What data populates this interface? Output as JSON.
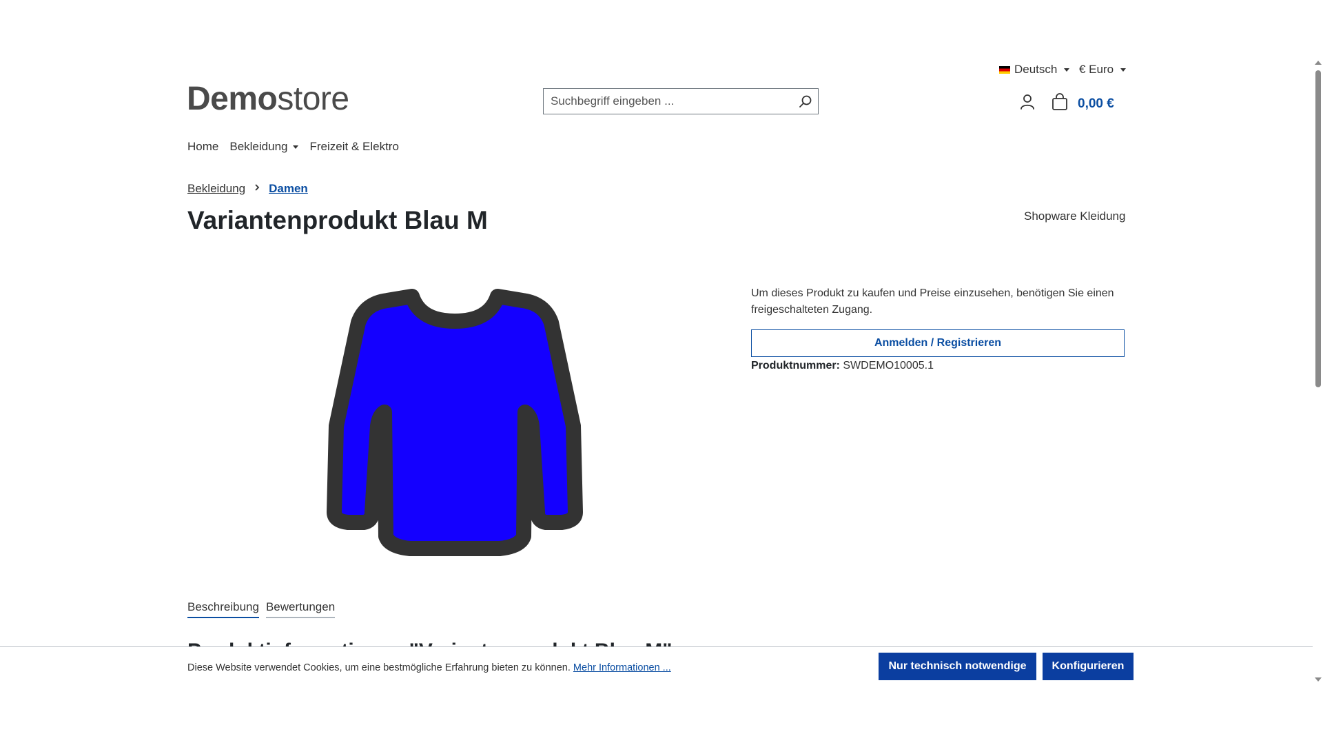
{
  "topbar": {
    "language": "Deutsch",
    "currency": "€ Euro"
  },
  "header": {
    "logo_bold": "Demo",
    "logo_light": "store",
    "search_placeholder": "Suchbegriff eingeben ...",
    "cart_total": "0,00 €"
  },
  "nav": {
    "items": [
      {
        "label": "Home",
        "has_dropdown": false
      },
      {
        "label": "Bekleidung",
        "has_dropdown": true
      },
      {
        "label": "Freizeit & Elektro",
        "has_dropdown": false
      }
    ]
  },
  "breadcrumb": {
    "items": [
      "Bekleidung",
      "Damen"
    ]
  },
  "product": {
    "title": "Variantenprodukt Blau M",
    "manufacturer": "Shopware Kleidung",
    "image_color": "#1400ff",
    "image_outline": "#333333",
    "buy_notice": "Um dieses Produkt zu kaufen und Preise einzusehen, benötigen Sie einen freigeschalteten Zugang.",
    "login_button": "Anmelden / Registrieren",
    "product_number_label": "Produktnummer:",
    "product_number": "SWDEMO10005.1"
  },
  "tabs": {
    "items": [
      "Beschreibung",
      "Bewertungen"
    ]
  },
  "description": {
    "title": "Produktinformationen \"Variantenprodukt Blau M\""
  },
  "cookie": {
    "text": "Diese Website verwendet Cookies, um eine bestmögliche Erfahrung bieten zu können.",
    "link": "Mehr Informationen ...",
    "btn_necessary": "Nur technisch notwendige",
    "btn_configure": "Konfigurieren"
  },
  "colors": {
    "primary": "#0b4ea2",
    "button_primary": "#0b3ea0"
  }
}
